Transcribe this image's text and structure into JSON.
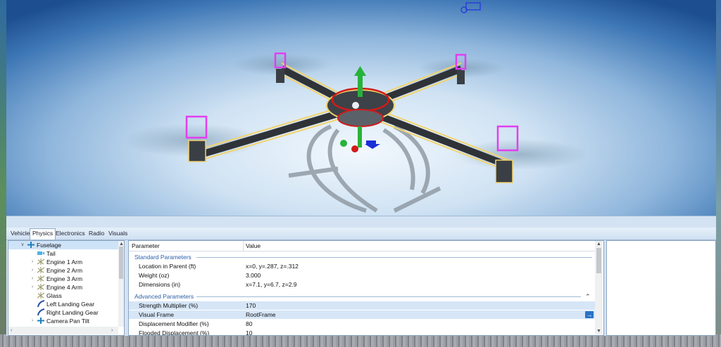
{
  "tabs": [
    "Vehicle",
    "Physics",
    "Electronics",
    "Radio",
    "Visuals"
  ],
  "active_tab": "Physics",
  "tree": [
    {
      "label": "Fuselage",
      "icon": "plus-fuselage-icon",
      "expander": "expanded",
      "selected": true
    },
    {
      "label": "Tail",
      "icon": "camera-icon",
      "expander": "none",
      "selected": false
    },
    {
      "label": "Engine 1 Arm",
      "icon": "engine-arm-icon",
      "expander": "collapsed",
      "selected": false
    },
    {
      "label": "Engine 2 Arm",
      "icon": "engine-arm-icon",
      "expander": "collapsed",
      "selected": false
    },
    {
      "label": "Engine 3 Arm",
      "icon": "engine-arm-icon",
      "expander": "collapsed",
      "selected": false
    },
    {
      "label": "Engine 4 Arm",
      "icon": "engine-arm-icon",
      "expander": "collapsed",
      "selected": false
    },
    {
      "label": "Glass",
      "icon": "engine-arm-icon",
      "expander": "none",
      "selected": false
    },
    {
      "label": "Left Landing Gear",
      "icon": "landing-gear-icon",
      "expander": "none",
      "selected": false
    },
    {
      "label": "Right Landing Gear",
      "icon": "landing-gear-icon",
      "expander": "none",
      "selected": false
    },
    {
      "label": "Camera Pan Tilt",
      "icon": "plus-fuselage-icon",
      "expander": "collapsed",
      "selected": false
    }
  ],
  "params": {
    "header_parameter": "Parameter",
    "header_value": "Value",
    "standard_section": "Standard Parameters",
    "standard_rows": [
      {
        "name": "Location in Parent (ft)",
        "value": "x=0, y=.287, z=.312"
      },
      {
        "name": "Weight (oz)",
        "value": "3.000"
      },
      {
        "name": "Dimensions (in)",
        "value": "x=7.1, y=6.7, z=2.9"
      }
    ],
    "advanced_section": "Advanced Parameters",
    "advanced_rows": [
      {
        "name": "Strength Multiplier (%)",
        "value": "170"
      },
      {
        "name": "Visual Frame",
        "value": "RootFrame"
      },
      {
        "name": "Displacement Modifier (%)",
        "value": "80"
      },
      {
        "name": "Flooded Displacement (%)",
        "value": "10"
      }
    ]
  },
  "colors": {
    "accent": "#2a72c8",
    "section_text": "#2b5fa8",
    "selection_outline": "#f2d36b",
    "engine_highlight": "#e23ef0"
  }
}
